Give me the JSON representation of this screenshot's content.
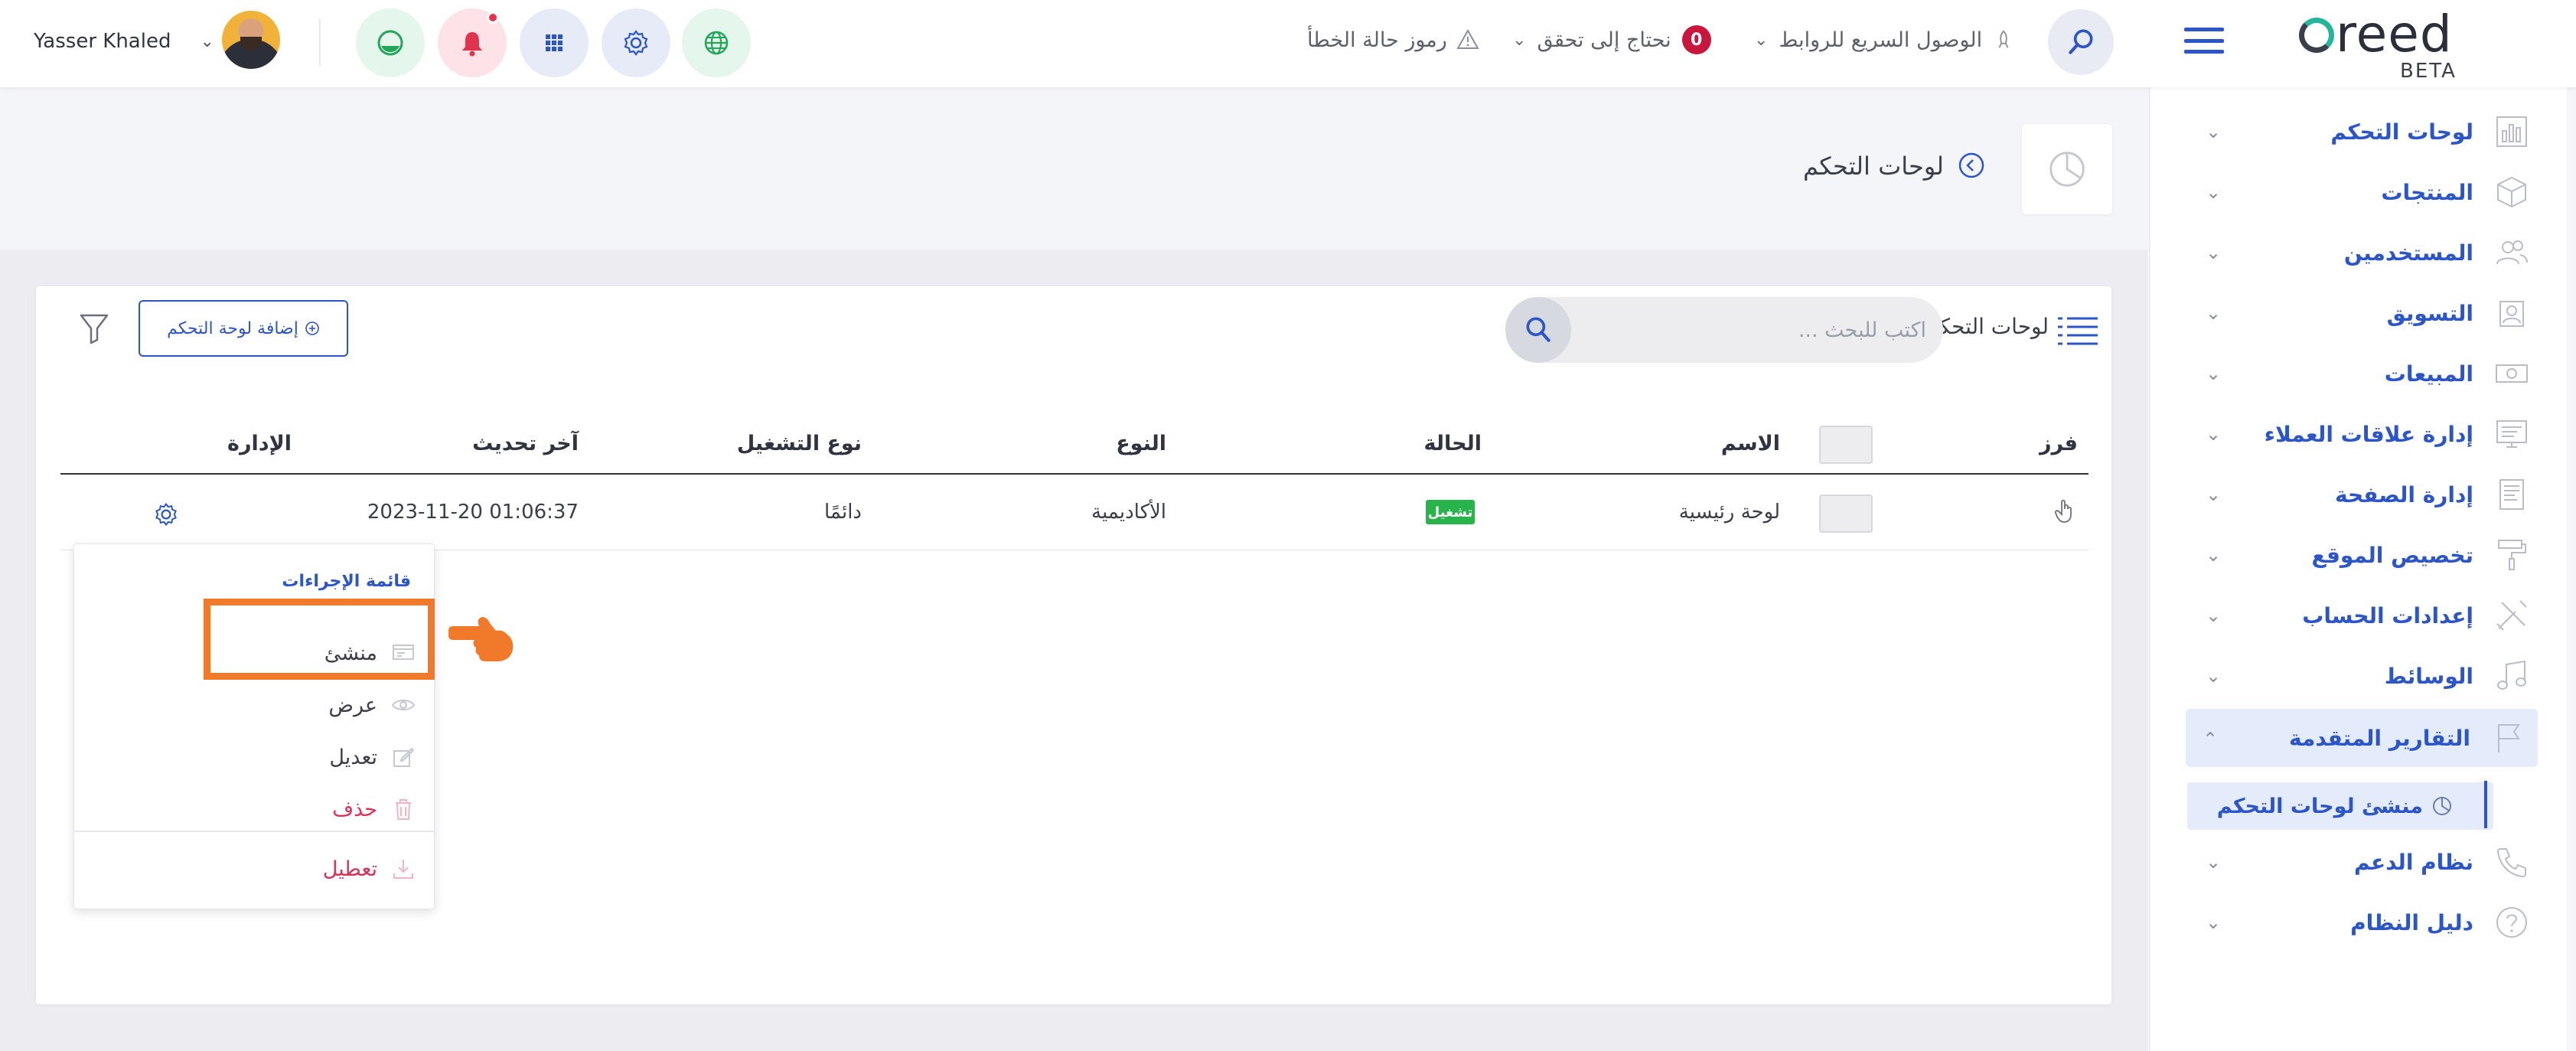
{
  "topbar": {
    "user_name": "Yasser Khaled",
    "quick_links": "الوصول السريع للروابط",
    "verify_label": "نحتاج إلى تحقق",
    "verify_count": "0",
    "error_codes": "رموز حالة الخطأ",
    "logo_text": "reed",
    "logo_beta": "BETA"
  },
  "sidebar": {
    "items": [
      {
        "label": "لوحات التحكم"
      },
      {
        "label": "المنتجات"
      },
      {
        "label": "المستخدمين"
      },
      {
        "label": "التسويق"
      },
      {
        "label": "المبيعات"
      },
      {
        "label": "إدارة علاقات العملاء"
      },
      {
        "label": "إدارة الصفحة"
      },
      {
        "label": "تخصيص الموقع"
      },
      {
        "label": "إعدادات الحساب"
      },
      {
        "label": "الوسائط"
      },
      {
        "label": "التقارير المتقدمة"
      },
      {
        "label": "نظام الدعم"
      },
      {
        "label": "دليل النظام"
      }
    ],
    "sub_item": "منشئ لوحات التحكم"
  },
  "page": {
    "title": "لوحات التحكم"
  },
  "card": {
    "header_label": "لوحات التحكم",
    "search_placeholder": "اكتب للبحث ...",
    "add_button": "إضافة لوحة التحكم",
    "columns": {
      "sort": "فرز",
      "name": "الاسم",
      "status": "الحالة",
      "type": "النوع",
      "run_type": "نوع التشغيل",
      "last_update": "آخر تحديث",
      "manage": "الإدارة"
    },
    "rows": [
      {
        "name": "لوحة رئيسية",
        "status": "تشغيل",
        "type": "الأكاديمية",
        "run_type": "دائمًا",
        "last_update": "2023-11-20 01:06:37"
      }
    ]
  },
  "dropdown": {
    "title": "قائمة الإجراءات",
    "items": {
      "builder": "منشئ",
      "view": "عرض",
      "edit": "تعديل",
      "delete": "حذف",
      "disable": "تعطيل"
    }
  },
  "colors": {
    "accent": "#2b55c8",
    "highlight": "#f07a2a",
    "status_green": "#28b34b",
    "danger": "#d7335b"
  }
}
